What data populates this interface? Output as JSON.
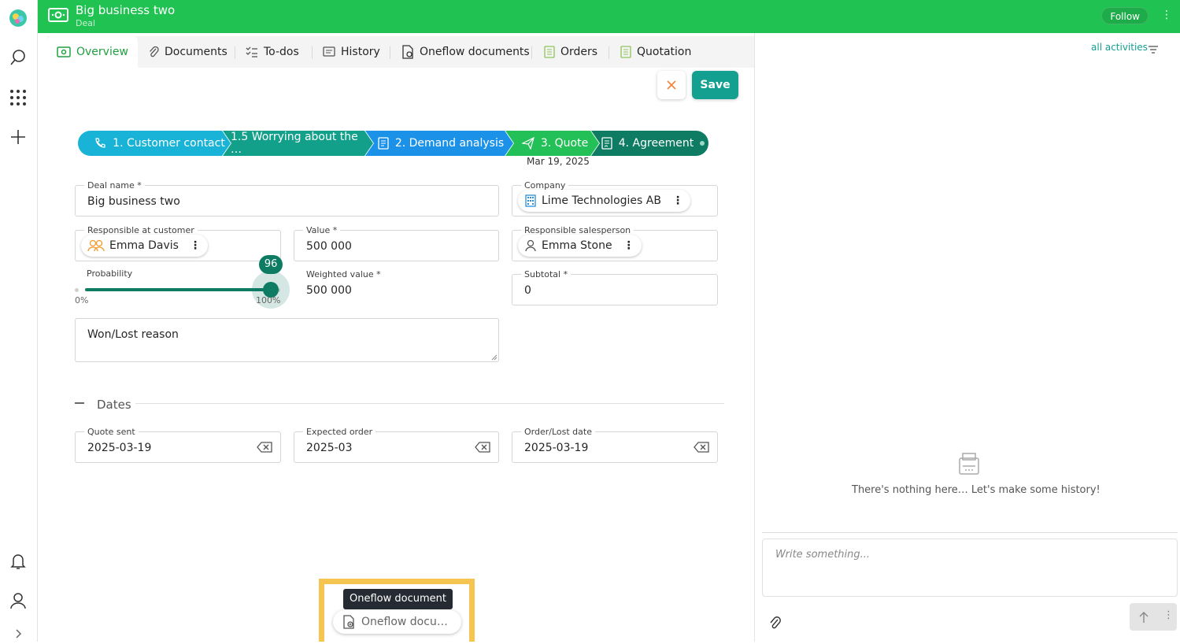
{
  "header": {
    "title": "Big business two",
    "subtitle": "Deal",
    "follow_label": "Follow",
    "color": "#20c252"
  },
  "tabs": [
    {
      "label": "Overview",
      "icon": "deal-icon"
    },
    {
      "label": "Documents",
      "icon": "paperclip-icon"
    },
    {
      "label": "To-dos",
      "icon": "checklist-icon"
    },
    {
      "label": "History",
      "icon": "history-icon"
    },
    {
      "label": "Oneflow documents",
      "icon": "oneflow-icon"
    },
    {
      "label": "Orders",
      "icon": "orders-icon"
    },
    {
      "label": "Quotation",
      "icon": "quotation-icon"
    }
  ],
  "actions": {
    "save_label": "Save"
  },
  "stages": [
    {
      "label": "1. Customer contact",
      "color": "#1ab3d8"
    },
    {
      "label": "1.5 Worrying about the …",
      "color": "#12a08b"
    },
    {
      "label": "2. Demand analysis",
      "color": "#1b92e8"
    },
    {
      "label": "3. Quote",
      "color": "#22c056",
      "date": "Mar 19, 2025"
    },
    {
      "label": "4. Agreement",
      "color": "#0e7b63"
    }
  ],
  "form": {
    "deal_name": {
      "label": "Deal name",
      "value": "Big business two"
    },
    "company": {
      "label": "Company",
      "value": "Lime Technologies AB"
    },
    "responsible_customer": {
      "label": "Responsible at customer",
      "value": "Emma Davis"
    },
    "value": {
      "label": "Value",
      "value": "500 000"
    },
    "responsible_salesperson": {
      "label": "Responsible salesperson",
      "value": "Emma Stone"
    },
    "probability": {
      "label": "Probability",
      "value": 96,
      "value_text": "96",
      "min_label": "0%",
      "max_label": "100%"
    },
    "weighted_value": {
      "label": "Weighted value",
      "value": "500 000"
    },
    "subtotal": {
      "label": "Subtotal",
      "value": "0"
    },
    "won_lost_reason": {
      "placeholder": "Won/Lost reason"
    }
  },
  "dates_section": {
    "title": "Dates",
    "quote_sent": {
      "label": "Quote sent",
      "value": "2025-03-19"
    },
    "expected_order": {
      "label": "Expected order",
      "value": "2025-03"
    },
    "order_lost_date": {
      "label": "Order/Lost date",
      "value": "2025-03-19"
    }
  },
  "history_panel": {
    "filter_label": "all activities",
    "empty_message": "There's nothing here… Let's make some history!",
    "composer_placeholder": "Write something..."
  },
  "oneflow_widget": {
    "tooltip": "Oneflow document",
    "chip_label": "Oneflow docu…",
    "highlight_color": "#f6c451"
  }
}
